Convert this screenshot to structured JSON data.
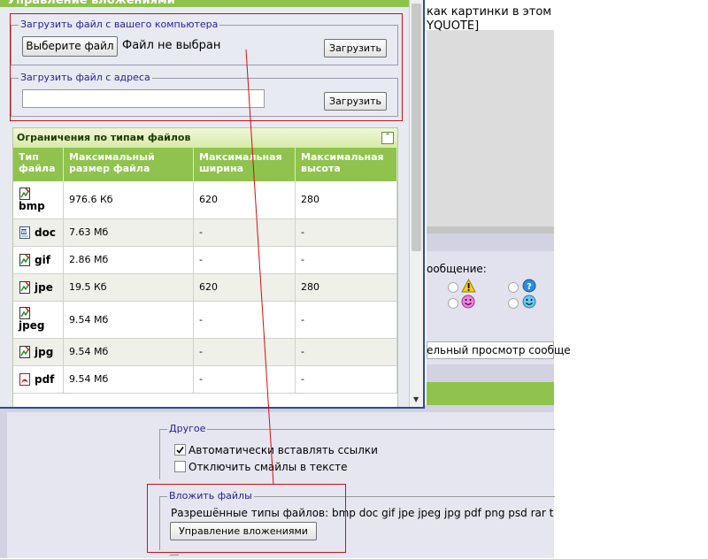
{
  "dialog": {
    "title": "Управление вложениями",
    "upload_computer": {
      "legend": "Загрузить файл с вашего компьютера",
      "choose_label": "Выберите файл",
      "no_file_text": "Файл не выбран",
      "upload_label": "Загрузить"
    },
    "upload_url": {
      "legend": "Загрузить файл с адреса",
      "url_value": "",
      "upload_label": "Загрузить"
    },
    "limits": {
      "title": "Ограничения по типам файлов",
      "collapse_glyph": "⌃",
      "headers": [
        "Тип файла",
        "Максимальный размер файла",
        "Максимальная ширина",
        "Максимальная высота"
      ],
      "rows": [
        {
          "ext": "bmp",
          "size": "976.6 Кб",
          "width": "620",
          "height": "280",
          "icon": "image-file-icon"
        },
        {
          "ext": "doc",
          "size": "7.63 Мб",
          "width": "-",
          "height": "-",
          "icon": "word-file-icon"
        },
        {
          "ext": "gif",
          "size": "2.86 Мб",
          "width": "-",
          "height": "-",
          "icon": "image-file-icon"
        },
        {
          "ext": "jpe",
          "size": "19.5 Кб",
          "width": "620",
          "height": "280",
          "icon": "image-file-icon"
        },
        {
          "ext": "jpeg",
          "size": "9.54 Мб",
          "width": "-",
          "height": "-",
          "icon": "image-file-icon"
        },
        {
          "ext": "jpg",
          "size": "9.54 Мб",
          "width": "-",
          "height": "-",
          "icon": "image-file-icon"
        },
        {
          "ext": "pdf",
          "size": "9.54 Мб",
          "width": "-",
          "height": "-",
          "icon": "pdf-file-icon"
        }
      ]
    }
  },
  "background": {
    "post_line1": "как картинки в этом",
    "post_line2": "YQUOTE]",
    "message_label": "ообщение:",
    "preview_text": "ельный просмотр сообще",
    "other_group": {
      "legend": "Другое",
      "auto_links_label": "Автоматически вставлять ссылки",
      "auto_links_checked": true,
      "disable_smilies_label": "Отключить смайлы в тексте",
      "disable_smilies_checked": false
    },
    "attach_group": {
      "legend": "Вложить файлы",
      "allowed_text": "Разрешённые типы файлов: bmp doc gif jpe jpeg jpg pdf png psd rar txt xl",
      "manage_label": "Управление вложениями"
    }
  },
  "colors": {
    "accent_green": "#8fc34d",
    "annotation_red": "#d01010",
    "legend_blue": "#22229a"
  }
}
